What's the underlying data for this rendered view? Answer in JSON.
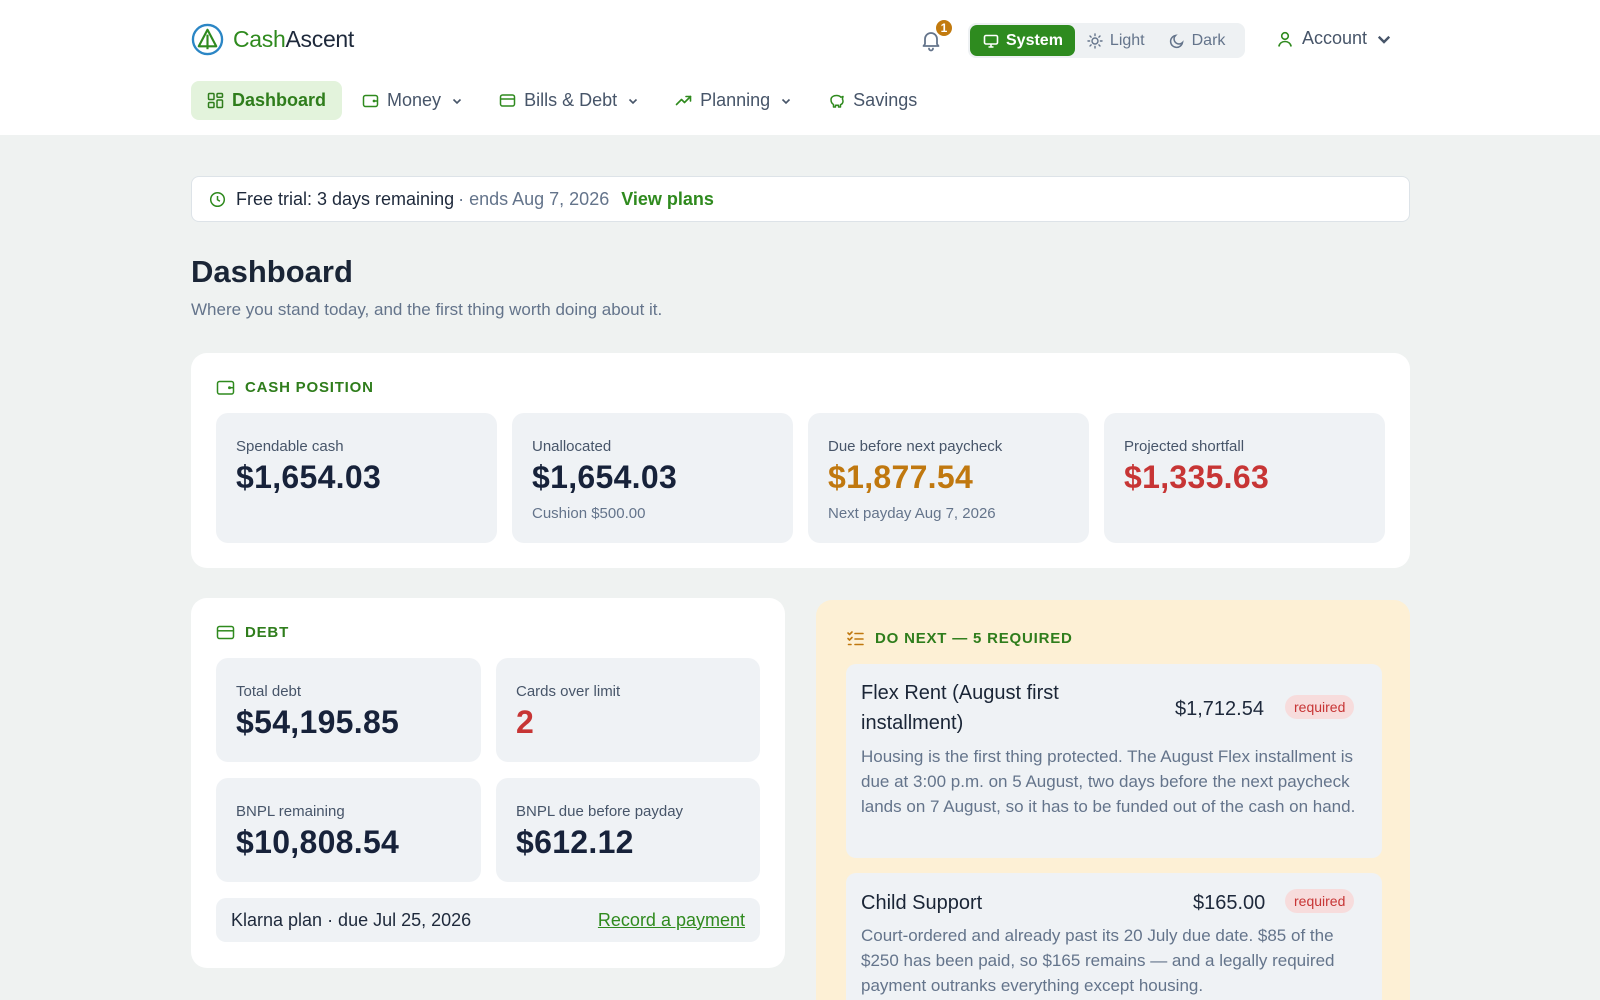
{
  "brand": {
    "name_part1": "Cash",
    "name_part2": "Ascent"
  },
  "notifications": {
    "count": "1"
  },
  "theme": {
    "system": "System",
    "light": "Light",
    "dark": "Dark"
  },
  "account": {
    "label": "Account"
  },
  "nav": {
    "dashboard": "Dashboard",
    "money": "Money",
    "bills": "Bills & Debt",
    "planning": "Planning",
    "savings": "Savings"
  },
  "trial": {
    "main": "Free trial: 3 days remaining",
    "ends": "· ends Aug 7, 2026",
    "link": "View plans"
  },
  "page": {
    "title": "Dashboard",
    "subtitle": "Where you stand today, and the first thing worth doing about it."
  },
  "cash_position": {
    "heading": "CASH POSITION",
    "spendable": {
      "label": "Spendable cash",
      "value": "$1,654.03"
    },
    "unallocated": {
      "label": "Unallocated",
      "value": "$1,654.03",
      "sub": "Cushion $500.00"
    },
    "due": {
      "label": "Due before next paycheck",
      "value": "$1,877.54",
      "sub": "Next payday Aug 7, 2026"
    },
    "shortfall": {
      "label": "Projected shortfall",
      "value": "$1,335.63"
    }
  },
  "debt": {
    "heading": "DEBT",
    "total": {
      "label": "Total debt",
      "value": "$54,195.85"
    },
    "over_limit": {
      "label": "Cards over limit",
      "value": "2"
    },
    "bnpl_remaining": {
      "label": "BNPL remaining",
      "value": "$10,808.54"
    },
    "bnpl_due": {
      "label": "BNPL due before payday",
      "value": "$612.12"
    },
    "klarna": {
      "text": "Klarna plan · due Jul 25, 2026",
      "link": "Record a payment"
    }
  },
  "do_next": {
    "heading": "DO NEXT — 5 REQUIRED",
    "tasks": [
      {
        "title_line1": "Flex Rent (August first",
        "title_line2": "installment)",
        "amount": "$1,712.54",
        "badge": "required",
        "body": "Housing is the first thing protected. The August Flex installment is due at 3:00 p.m. on 5 August, two days before the next paycheck lands on 7 August, so it has to be funded out of the cash on hand."
      },
      {
        "title_line1": "Child Support",
        "amount": "$165.00",
        "badge": "required",
        "body": "Court-ordered and already past its 20 July due date. $85 of the $250 has been paid, so $165 remains — and a legally required payment outranks everything except housing."
      }
    ]
  },
  "colors": {
    "brand_green": "#2f8a1e",
    "amber": "#c0780f",
    "red": "#c73535",
    "do_next_bg": "#fdf0d5"
  }
}
